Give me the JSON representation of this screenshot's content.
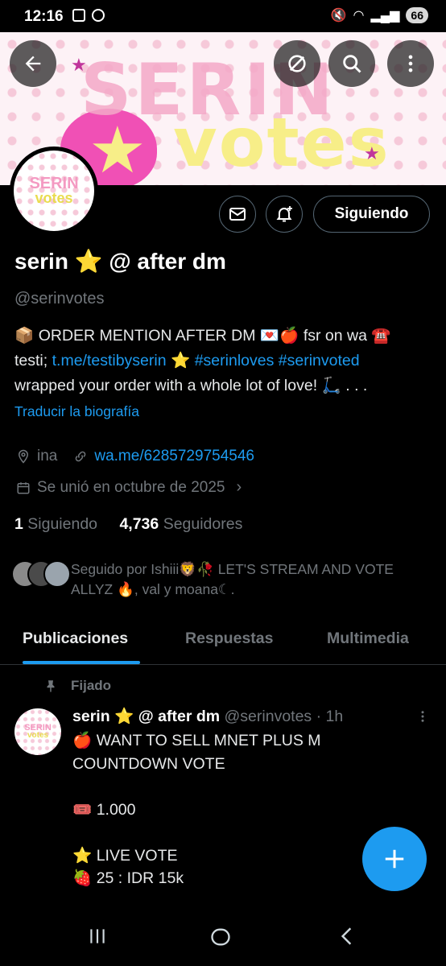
{
  "status_bar": {
    "time": "12:16",
    "battery": "66"
  },
  "banner": {
    "word_top": "SERIN",
    "word_bottom": "votes"
  },
  "avatar": {
    "line1": "SERIN",
    "line2": "votes"
  },
  "profile": {
    "follow_label": "Siguiendo",
    "name": "serin ⭐ @ after dm",
    "handle": "@serinvotes",
    "bio_line1": "📦 ORDER MENTION AFTER DM 💌🍎 fsr on wa ☎️",
    "bio_line2_prefix": "testi; ",
    "bio_link": "t.me/testibyserin",
    "bio_star": " ⭐ ",
    "bio_tags": "#serinloves #serinvoted",
    "bio_line3": "wrapped your order with a whole lot of love! 🛴 . . .",
    "translate_label": "Traducir la biografía",
    "location": "ina",
    "website": "wa.me/6285729754546",
    "joined": "Se unió en octubre de 2025",
    "following_count": "1",
    "following_label": "Siguiendo",
    "followers_count": "4,736",
    "followers_label": "Seguidores",
    "followed_by": "Seguido por Ishiii🦁🥀 LET'S STREAM AND VOTE ALLYZ 🔥, val y moana☾."
  },
  "tabs": [
    {
      "label": "Publicaciones",
      "active": true
    },
    {
      "label": "Respuestas",
      "active": false
    },
    {
      "label": "Multimedia",
      "active": false
    }
  ],
  "post": {
    "pinned_label": "Fijado",
    "author": "serin ⭐ @ after dm",
    "handle_time": " @serinvotes · 1h",
    "body": "🍎 WANT TO SELL MNET PLUS M COUNTDOWN VOTE\n\n🎟️ 1.000\n\n⭐ LIVE VOTE\n🍓 25 : IDR 15k"
  },
  "colors": {
    "accent": "#1d9bf0",
    "background": "#000000",
    "muted": "#71767b"
  }
}
